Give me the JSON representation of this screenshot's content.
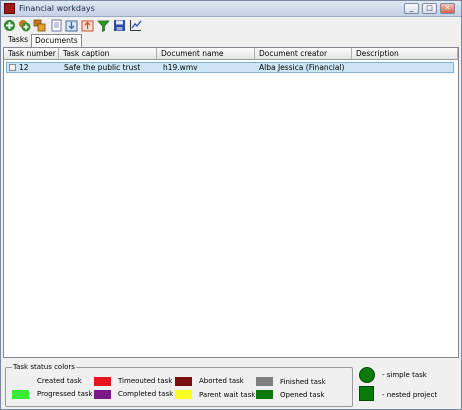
{
  "window": {
    "title": "Financial workdays",
    "minimize": "_",
    "maximize": "□",
    "close": "✕"
  },
  "toolbar": [
    {
      "icon": "add-icon",
      "color": "#2e8b2e"
    },
    {
      "icon": "add-multiple-icon",
      "color": "#3a8a3a"
    },
    {
      "icon": "group-icon",
      "color": "#c27a18"
    },
    {
      "icon": "document-icon",
      "color": "#6a7aa8"
    },
    {
      "icon": "import-icon",
      "color": "#3c6aa8"
    },
    {
      "icon": "export-icon",
      "color": "#c8502a"
    },
    {
      "icon": "filter-icon",
      "color": "#2a9a2a"
    },
    {
      "icon": "save-icon",
      "color": "#2a4aa8"
    },
    {
      "icon": "chart-icon",
      "color": "#2a5ab8"
    }
  ],
  "tabs": [
    {
      "label": "Tasks"
    },
    {
      "label": "Documents"
    }
  ],
  "grid": {
    "columns": [
      "Task number",
      "Task caption",
      "Document name",
      "Document creator",
      "Description"
    ],
    "rows": [
      {
        "task_number": "12",
        "task_caption": "Safe the public trust",
        "document_name": "h19.wmv",
        "document_creator": "Alba Jessica (Financial)",
        "description": ""
      }
    ]
  },
  "legend": {
    "title": "Task status colors",
    "items": [
      {
        "label": "Created task",
        "color": "#f0f0f0"
      },
      {
        "label": "Timeouted task",
        "color": "#e8141e"
      },
      {
        "label": "Aborted task",
        "color": "#7a0d0d"
      },
      {
        "label": "Finished task",
        "color": "#808080"
      },
      {
        "label": "Progressed task",
        "color": "#39ea39"
      },
      {
        "label": "Completed task",
        "color": "#7a1a8a"
      },
      {
        "label": "Parent wait task",
        "color": "#ffff20"
      },
      {
        "label": "Opened task",
        "color": "#0b7a0b"
      }
    ]
  },
  "shapes": {
    "simple_task": "- simple task",
    "nested_project": "- nested project"
  }
}
